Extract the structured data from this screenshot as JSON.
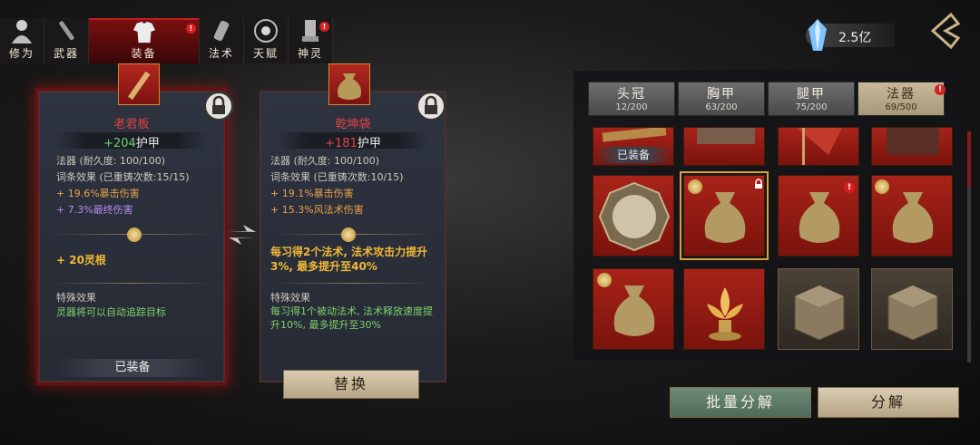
{
  "tabs": [
    {
      "label": "修为",
      "icon": "cultivation-icon",
      "badge": ""
    },
    {
      "label": "武器",
      "icon": "weapon-icon",
      "badge": ""
    },
    {
      "label": "装备",
      "icon": "armor-icon",
      "badge": "!"
    },
    {
      "label": "法术",
      "icon": "spell-icon",
      "badge": ""
    },
    {
      "label": "天赋",
      "icon": "talent-icon",
      "badge": ""
    },
    {
      "label": "神灵",
      "icon": "deity-icon",
      "badge": "!"
    }
  ],
  "currency": {
    "amount": "2.5亿",
    "icon": "crystal-icon"
  },
  "left_card": {
    "name": "老君板",
    "armor_value": "+204",
    "armor_label": "护甲",
    "durability": "法器  (耐久度: 100/100)",
    "affix_header": "词条效果  (已重铸次数:15/15)",
    "affixes": [
      {
        "text": "+ 19.6%暴击伤害",
        "color": "orange"
      },
      {
        "text": "+ 7.3%最终伤害",
        "color": "purple"
      }
    ],
    "bonus": "+ 20灵根",
    "special_header": "特殊效果",
    "special_text": "灵器将可以自动追踪目标",
    "status": "已装备"
  },
  "right_card": {
    "name": "乾坤袋",
    "armor_value": "+181",
    "armor_label": "护甲",
    "durability": "法器  (耐久度: 100/100)",
    "affix_header": "词条效果  (已重铸次数:10/15)",
    "affixes": [
      {
        "text": "+ 19.1%暴击伤害",
        "color": "orange"
      },
      {
        "text": "+ 15.3%风法术伤害",
        "color": "orange"
      }
    ],
    "bonus": "每习得2个法术, 法术攻击力提升3%, 最多提升至40%",
    "special_header": "特殊效果",
    "special_text": "每习得1个被动法术, 法术释放速度提升10%, 最多提升至30%",
    "replace_label": "替换"
  },
  "panel": {
    "tabs": [
      {
        "name": "头冠",
        "count": "12/200"
      },
      {
        "name": "胸甲",
        "count": "63/200"
      },
      {
        "name": "腿甲",
        "count": "75/200"
      },
      {
        "name": "法器",
        "count": "69/500"
      }
    ],
    "equipped_label": "已装备",
    "batch_label": "批量分解",
    "decompose_label": "分解"
  },
  "colors": {
    "accent_red": "#c21d1d",
    "orange": "#e8a24a",
    "purple": "#b58df0",
    "green": "#7dd36b",
    "yellow": "#f0b838"
  }
}
